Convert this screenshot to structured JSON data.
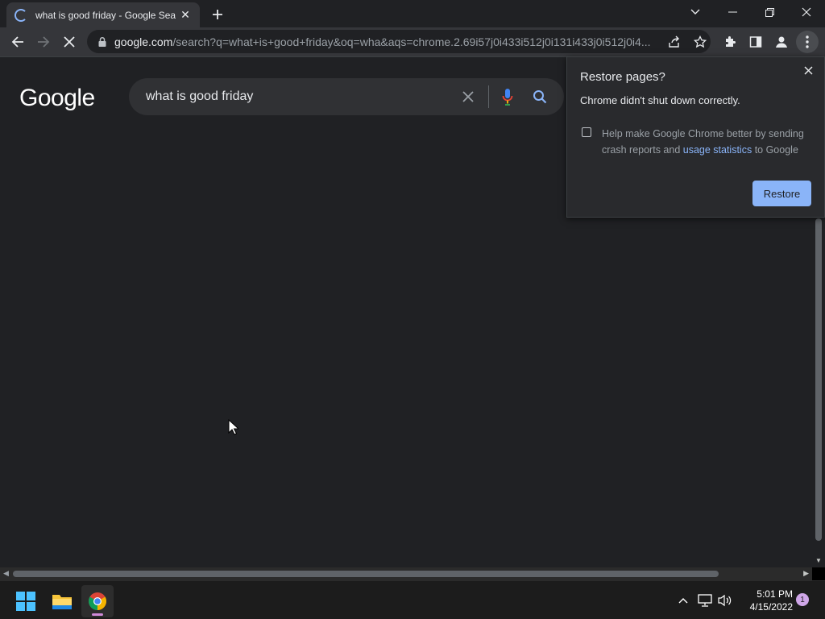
{
  "tab": {
    "title": "what is good friday - Google Search",
    "close_glyph": "✕",
    "new_tab_glyph": "+"
  },
  "toolbar": {
    "url_host": "google.com",
    "url_path": "/search?q=what+is+good+friday&oq=wha&aqs=chrome.2.69i57j0i433i512j0i131i433j0i512j0i4..."
  },
  "search": {
    "logo": "Google",
    "query": "what is good friday"
  },
  "popup": {
    "title": "Restore pages?",
    "message": "Chrome didn't shut down correctly.",
    "checkbox_text_before": "Help make Google Chrome better by sending crash reports and ",
    "checkbox_link": "usage statistics",
    "checkbox_text_after": " to Google",
    "restore_label": "Restore"
  },
  "taskbar": {
    "time": "5:01 PM",
    "date": "4/15/2022",
    "notification_count": "1"
  },
  "colors": {
    "background": "#202124",
    "accent": "#8ab4f8",
    "toolbar": "#35363a"
  }
}
